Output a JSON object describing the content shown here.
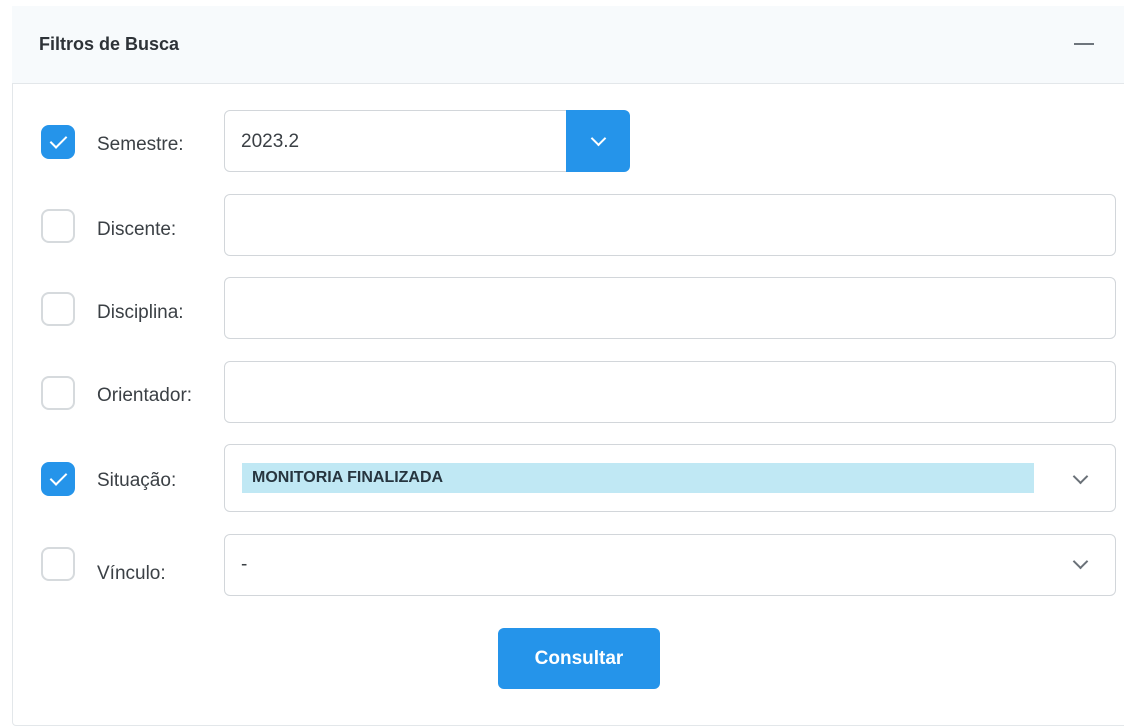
{
  "panel": {
    "title": "Filtros de Busca",
    "collapse_icon": "minus-icon"
  },
  "filters": {
    "semestre": {
      "label": "Semestre:",
      "checked": true,
      "value": "2023.2",
      "button_icon": "chevron-down-icon"
    },
    "discente": {
      "label": "Discente:",
      "checked": false,
      "value": ""
    },
    "disciplina": {
      "label": "Disciplina:",
      "checked": false,
      "value": ""
    },
    "orientador": {
      "label": "Orientador:",
      "checked": false,
      "value": ""
    },
    "situacao": {
      "label": "Situação:",
      "checked": true,
      "selected": "MONITORIA FINALIZADA",
      "icon": "chevron-down-icon"
    },
    "vinculo": {
      "label": "Vínculo:",
      "checked": false,
      "selected": "-",
      "icon": "chevron-down-icon"
    }
  },
  "actions": {
    "consultar_label": "Consultar"
  },
  "colors": {
    "accent": "#2594ea",
    "tag_background": "#c0e8f4",
    "header_background": "#f7fafc"
  }
}
